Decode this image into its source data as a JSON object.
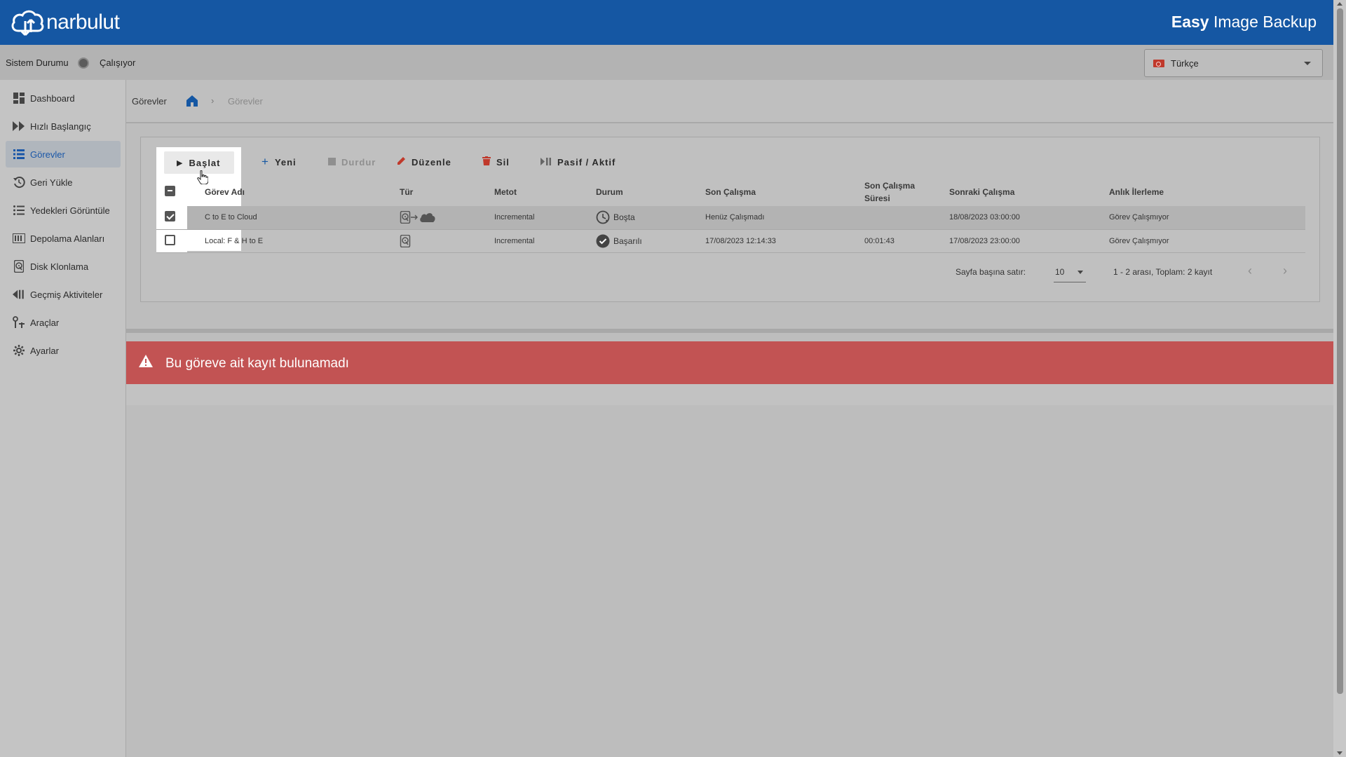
{
  "header": {
    "logo_text": "narbulut",
    "app_title_bold": "Easy",
    "app_title_rest": " Image Backup",
    "bg_color": "#1557a3"
  },
  "status": {
    "label": "Sistem Durumu",
    "value": "Çalışıyor"
  },
  "language": {
    "selected": "Türkçe",
    "flag": "turkey-flag-icon"
  },
  "sidebar": {
    "items": [
      {
        "label": "Dashboard",
        "icon": "dashboard-icon"
      },
      {
        "label": "Hızlı Başlangıç",
        "icon": "fast-forward-icon"
      },
      {
        "label": "Görevler",
        "icon": "list-icon",
        "active": true
      },
      {
        "label": "Geri Yükle",
        "icon": "restore-icon"
      },
      {
        "label": "Yedekleri Görüntüle",
        "icon": "list-view-icon"
      },
      {
        "label": "Depolama Alanları",
        "icon": "storage-icon"
      },
      {
        "label": "Disk Klonlama",
        "icon": "disk-icon"
      },
      {
        "label": "Geçmiş Aktiviteler",
        "icon": "history-icon"
      },
      {
        "label": "Araçlar",
        "icon": "tools-icon"
      },
      {
        "label": "Ayarlar",
        "icon": "gear-icon"
      }
    ]
  },
  "breadcrumb": {
    "title": "Görevler",
    "current": "Görevler",
    "separator": "›"
  },
  "toolbar": {
    "start_label": "Başlat",
    "new_label": "Yeni",
    "stop_label": "Durdur",
    "edit_label": "Düzenle",
    "delete_label": "Sil",
    "toggle_label": "Pasif / Aktif"
  },
  "table": {
    "columns": {
      "name": "Görev Adı",
      "type": "Tür",
      "method": "Metot",
      "status": "Durum",
      "last_run": "Son Çalışma",
      "last_duration_1": "Son Çalışma",
      "last_duration_2": "Süresi",
      "next_run": "Sonraki Çalışma",
      "instant_progress": "Anlık İlerleme"
    },
    "rows": [
      {
        "checked": true,
        "name": "C to E to Cloud",
        "type_icons": [
          "disk-icon",
          "arrow-right-icon",
          "cloud-icon"
        ],
        "method": "Incremental",
        "status": "Boşta",
        "status_icon": "clock-icon",
        "last_run": "Henüz Çalışmadı",
        "last_duration": "",
        "next_run": "18/08/2023 03:00:00",
        "instant_progress": "Görev Çalışmıyor"
      },
      {
        "checked": false,
        "name": "Local: F & H to E",
        "type_icons": [
          "disk-icon"
        ],
        "method": "Incremental",
        "status": "Başarılı",
        "status_icon": "check-circle-icon",
        "last_run": "17/08/2023 12:14:33",
        "last_duration": "00:01:43",
        "next_run": "17/08/2023 23:00:00",
        "instant_progress": "Görev Çalışmıyor"
      }
    ]
  },
  "pagination": {
    "rows_per_page_label": "Sayfa başına satır:",
    "rows_per_page": "10",
    "range": "1 - 2 arası, Toplam: 2 kayıt",
    "prev": "‹",
    "next": "›"
  },
  "alert": {
    "text": "Bu göreve ait kayıt bulunamadı",
    "color": "#c25353"
  }
}
